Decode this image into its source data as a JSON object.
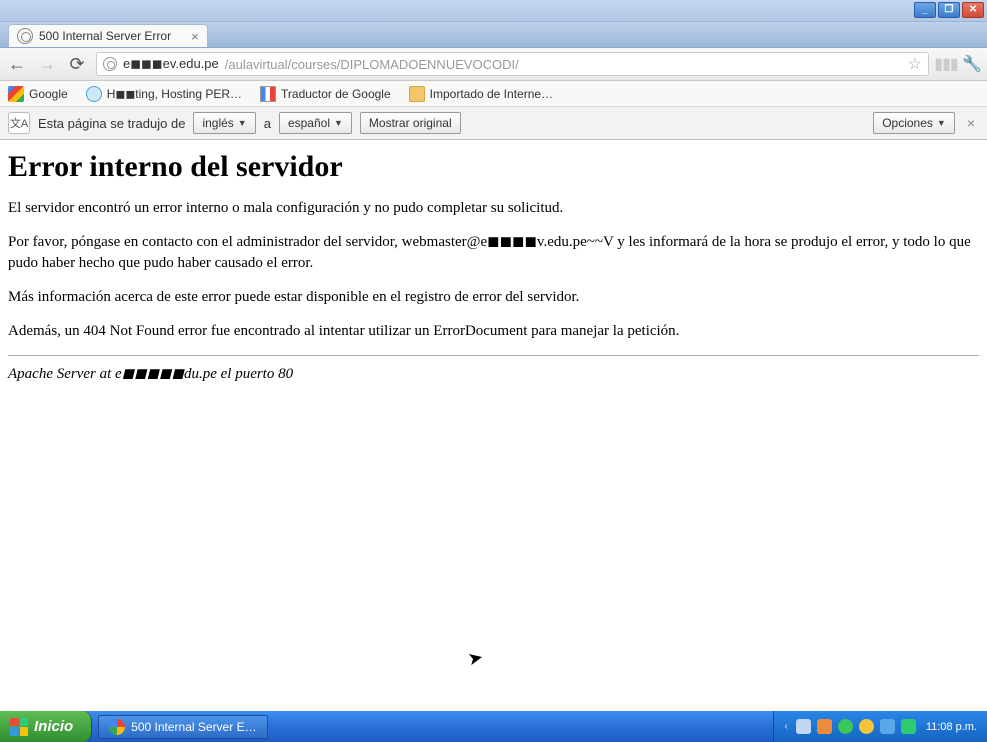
{
  "window": {
    "min": "_",
    "max": "❐",
    "close": "✕"
  },
  "tab": {
    "title": "500 Internal Server Error",
    "close": "×"
  },
  "nav": {
    "back": "←",
    "forward": "→",
    "reload": "⟳",
    "url_host": "e◼◼◼ev.edu.pe",
    "url_path": "/aulavirtual/courses/DIPLOMADOENNUEVOCODI/",
    "star": "☆",
    "bars": "▮▮▮",
    "wrench": "🔧"
  },
  "bookmarks": {
    "google": "Google",
    "hosting": "H◼◼ting, Hosting PER…",
    "traductor": "Traductor de Google",
    "importado": "Importado de Interne…"
  },
  "translate": {
    "label": "Esta página se tradujo de",
    "from": "inglés",
    "to_word": "a",
    "to": "español",
    "show_original": "Mostrar original",
    "options": "Opciones",
    "close": "×",
    "caret": "▼",
    "icon_text": "文A"
  },
  "page": {
    "h1": "Error interno del servidor",
    "p1": "El servidor encontró un error interno o mala configuración y no pudo completar su solicitud.",
    "p2": "Por favor, póngase en contacto con el administrador del servidor, webmaster@e◼◼◼◼v.edu.pe~~V y les informará de la hora se produjo el error, y todo lo que pudo haber hecho que pudo haber causado el error.",
    "p3": "Más información acerca de este error puede estar disponible en el registro de error del servidor.",
    "p4": "Además, un 404 Not Found error fue encontrado al intentar utilizar un ErrorDocument para manejar la petición.",
    "footer": "Apache Server at e◼◼◼◼◼du.pe el puerto 80"
  },
  "taskbar": {
    "start": "Inicio",
    "task_title": "500 Internal Server E…",
    "clock": "11:08 p.m.",
    "chev": "‹"
  }
}
